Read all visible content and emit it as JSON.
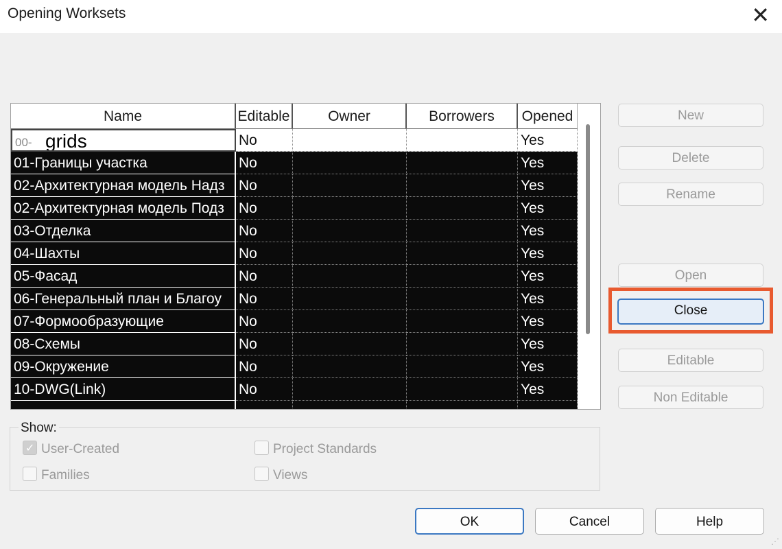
{
  "window": {
    "title": "Opening Worksets",
    "close_glyph": "✕"
  },
  "table": {
    "columns": [
      "Name",
      "Editable",
      "Owner",
      "Borrowers",
      "Opened"
    ],
    "first_row": {
      "prefix": "00-",
      "edit_value": "grids",
      "editable": "No",
      "owner": "",
      "borrowers": "",
      "opened": "Yes"
    },
    "rows": [
      {
        "name": "01-Границы участка",
        "editable": "No",
        "owner": "",
        "borrowers": "",
        "opened": "Yes"
      },
      {
        "name": "02-Архитектурная модель Надз",
        "editable": "No",
        "owner": "",
        "borrowers": "",
        "opened": "Yes"
      },
      {
        "name": "02-Архитектурная модель Подз",
        "editable": "No",
        "owner": "",
        "borrowers": "",
        "opened": "Yes"
      },
      {
        "name": "03-Отделка",
        "editable": "No",
        "owner": "",
        "borrowers": "",
        "opened": "Yes"
      },
      {
        "name": "04-Шахты",
        "editable": "No",
        "owner": "",
        "borrowers": "",
        "opened": "Yes"
      },
      {
        "name": "05-Фасад",
        "editable": "No",
        "owner": "",
        "borrowers": "",
        "opened": "Yes"
      },
      {
        "name": "06-Генеральный план и Благоу",
        "editable": "No",
        "owner": "",
        "borrowers": "",
        "opened": "Yes"
      },
      {
        "name": "07-Формообразующие",
        "editable": "No",
        "owner": "",
        "borrowers": "",
        "opened": "Yes"
      },
      {
        "name": "08-Схемы",
        "editable": "No",
        "owner": "",
        "borrowers": "",
        "opened": "Yes"
      },
      {
        "name": "09-Окружение",
        "editable": "No",
        "owner": "",
        "borrowers": "",
        "opened": "Yes"
      },
      {
        "name": "10-DWG(Link)",
        "editable": "No",
        "owner": "",
        "borrowers": "",
        "opened": "Yes"
      }
    ]
  },
  "side_buttons": {
    "new": "New",
    "delete": "Delete",
    "rename": "Rename",
    "open": "Open",
    "close": "Close",
    "editable": "Editable",
    "non_editable": "Non Editable"
  },
  "show": {
    "label": "Show:",
    "user_created": {
      "label": "User-Created",
      "checked": true
    },
    "project_standards": {
      "label": "Project Standards",
      "checked": false
    },
    "families": {
      "label": "Families",
      "checked": false
    },
    "views": {
      "label": "Views",
      "checked": false
    }
  },
  "footer": {
    "ok": "OK",
    "cancel": "Cancel",
    "help": "Help"
  },
  "colors": {
    "highlight": "#e85a2f",
    "focus_blue": "#3b78c2",
    "row_selected_bg": "#0b0b0b"
  }
}
